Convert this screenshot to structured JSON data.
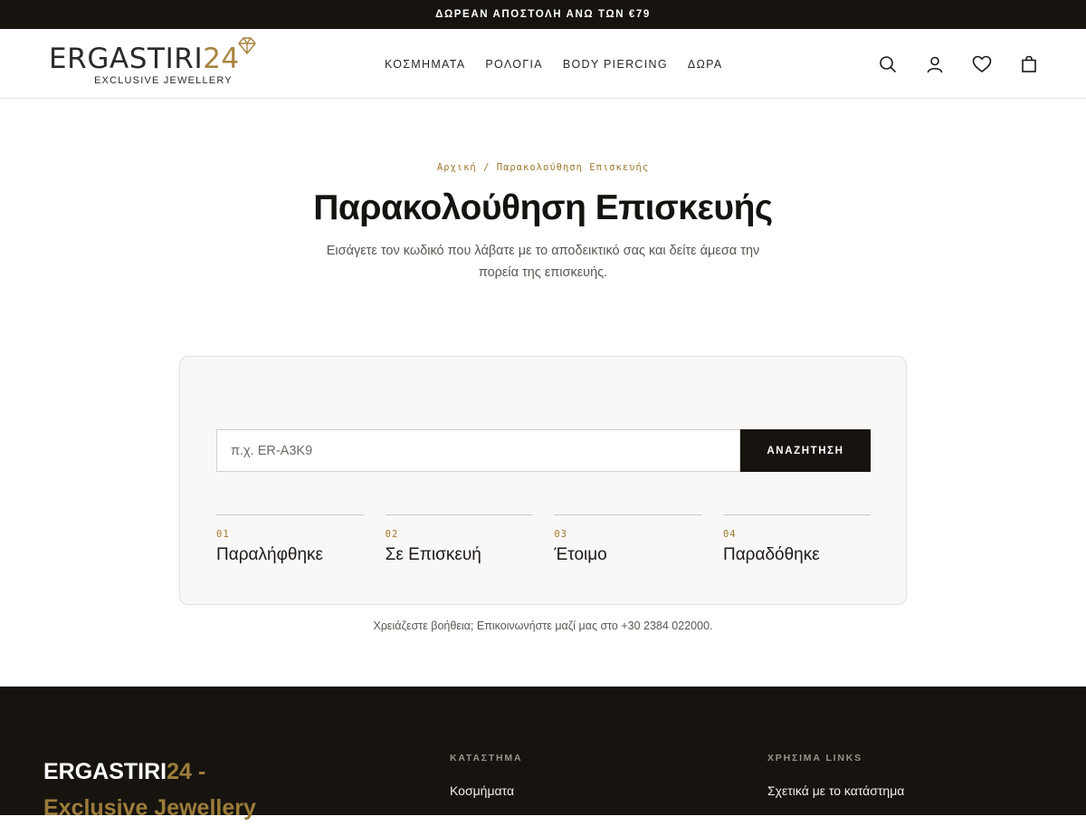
{
  "topbar": {
    "text": "ΔΩΡΕΑΝ ΑΠΟΣΤΟΛΗ ΑΝΩ ΤΩΝ €79"
  },
  "logo": {
    "main": "ERGASTIRI",
    "num": "24",
    "sub": "EXCLUSIVE JEWELLERY"
  },
  "nav": {
    "items": [
      "ΚΟΣΜΗΜΑΤΑ",
      "ΡΟΛΟΓΙΑ",
      "BODY PIERCING",
      "ΔΩΡΑ"
    ]
  },
  "header_icons": [
    "search-icon",
    "account-icon",
    "wishlist-heart-icon",
    "shopping-bag-icon"
  ],
  "breadcrumb": {
    "home": "Αρχική",
    "separator": "/",
    "current": "Παρακολούθηση Επισκευής"
  },
  "hero": {
    "title": "Παρακολούθηση Επισκευής",
    "description": "Εισάγετε τον κωδικό που λάβατε με το αποδεικτικό σας και δείτε άμεσα την πορεία της επισκευής."
  },
  "search": {
    "placeholder": "π.χ. ER-A3K9",
    "value": "",
    "button_label": "ΑΝΑΖΗΤΗΣΗ"
  },
  "steps": [
    {
      "num": "01",
      "label": "Παραλήφθηκε"
    },
    {
      "num": "02",
      "label": "Σε Επισκευή"
    },
    {
      "num": "03",
      "label": "Έτοιμο"
    },
    {
      "num": "04",
      "label": "Παραδόθηκε"
    }
  ],
  "help_text": "Χρειάζεστε βοήθεια; Επικοινωνήστε μαζί μας στο +30 2384 022000.",
  "footer": {
    "brand_white": "ERGASTIRI",
    "brand_gold_1": "24 -",
    "brand_gold_2": "Exclusive Jewellery",
    "col1": {
      "heading": "ΚΑΤΑΣΤΗΜΑ",
      "links": [
        "Κοσμήματα"
      ]
    },
    "col2": {
      "heading": "ΧΡΗΣΙΜΑ LINKS",
      "links": [
        "Σχετικά με το κατάστημα"
      ]
    }
  },
  "colors": {
    "accent_gold": "#a07a2e",
    "dark": "#17140f",
    "card_bg": "#f9f8f6"
  }
}
